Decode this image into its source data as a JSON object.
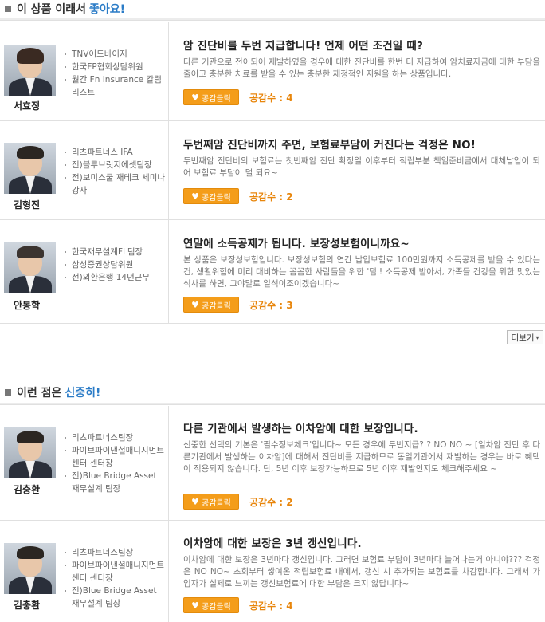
{
  "section1": {
    "title_prefix": "이 상품 이래서",
    "title_accent": "좋아요!"
  },
  "section2": {
    "title_prefix": "이런 점은",
    "title_accent": "신중히!"
  },
  "more_button": {
    "label": "더보기"
  },
  "agree_label": "공감클릭",
  "agree_count_prefix": "공감수 :",
  "icons": {
    "agree": "heart-icon",
    "more": "chevron-down-icon"
  },
  "colors": {
    "accent_blue": "#2b7cc7",
    "agree_orange": "#f49d1a",
    "count_orange": "#e8860c"
  },
  "pros": [
    {
      "name": "서효정",
      "credentials": [
        "TNV어드바이저",
        "한국FP협회상담위원",
        "월간 Fn Insurance 칼럼리스트"
      ],
      "headline": "암 진단비를 두번 지급합니다! 언제 어떤 조건일 때?",
      "description": "다른 기관으로 전이되어 재발하였을 경우에 대한 진단비를 한번 더 지급하여 암치료자금에 대한 부담을 줄이고 충분한 치료를 받을 수 있는 충분한 재정적인 지원을 하는 상품입니다.",
      "agree_count": "4"
    },
    {
      "name": "김형진",
      "credentials": [
        "리츠파트너스 IFA",
        "전)블루브릿지에셋팀장",
        "전)보미스쿨 재테크 세미나 강사"
      ],
      "headline": "두번째암 진단비까지 주면, 보험료부담이 커진다는 걱정은 NO!",
      "description": "두번째암 진단비의 보험료는 첫번째암 진단 확정일 이후부터 적립부분 책임준비금에서 대체납입이 되어 보험료 부담이 덜 되요~",
      "agree_count": "2"
    },
    {
      "name": "안봉학",
      "credentials": [
        "한국재무설계FL팀장",
        "삼성증권상담위원",
        "전)외환은행 14년근무"
      ],
      "headline": "연말에 소득공제가 됩니다. 보장성보험이니까요~",
      "description": "본 상품은 보장성보험입니다. 보장성보험의 연간 납입보험료 100만원까지 소득공제를 받을 수 있다는 건, 생활위험에 미리 대비하는 꼼꼼한 사람들을 위한 '덤'! 소득공제 받아서, 가족들 건강을 위한 맛있는 식사를 하면, 그야말로 일석이조이겠습니다~",
      "agree_count": "3"
    }
  ],
  "cons": [
    {
      "name": "김충환",
      "credentials": [
        "리츠파트너스팀장",
        "파이브파이낸셜매니지먼트센터 센터장",
        "전)Blue Bridge Asset 재무설계 팀장"
      ],
      "headline": "다른 기관에서 발생하는 이차암에 대한 보장입니다.",
      "description": "신중한 선택의 기본은 '필수정보체크'입니다~ 모든 경우에 두번지급? ? NO NO ~ [일차암 진단 후 다른기관에서 발생하는 이차암]에 대해서 진단비를 지급하므로 동일기관에서 재발하는 경우는 바로 혜택이 적용되지 않습니다. 단, 5년 이후 보장가능하므로 5년 이후 재발인지도 체크해주세요 ~",
      "agree_count": "2"
    },
    {
      "name": "김충환",
      "credentials": [
        "리츠파트너스팀장",
        "파이브파이낸셜매니지먼트센터 센터장",
        "전)Blue Bridge Asset 재무설계 팀장"
      ],
      "headline": "이차암에 대한 보장은 3년 갱신입니다.",
      "description": "이차암에 대한 보장은 3년마다 갱신입니다. 그러면 보험료 부담이 3년마다 늘어나는거 아니야??? 걱정은 NO NO~ 초회부터 쌓여온 적립보험료 내에서, 갱신 시 추가되는 보험료를 차감합니다. 그래서 가입자가 실제로 느끼는 갱신보험료에 대한 부담은 크지 않답니다~",
      "agree_count": "4"
    }
  ]
}
